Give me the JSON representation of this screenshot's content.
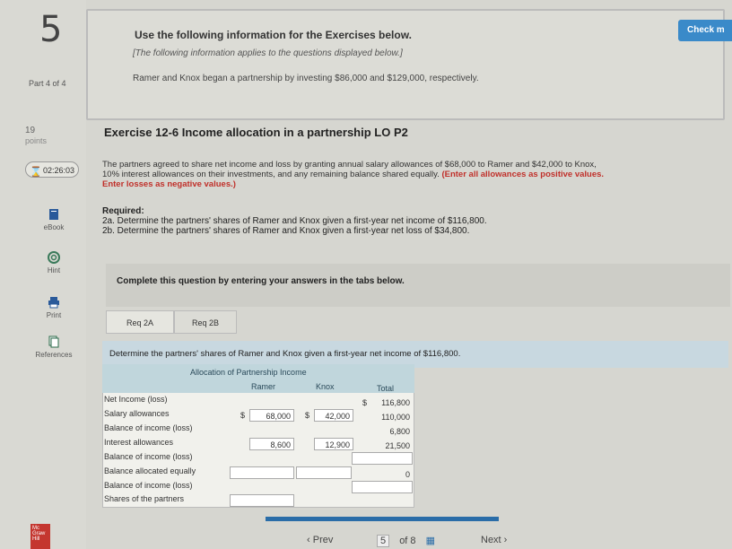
{
  "question_number": "5",
  "part": "Part 4 of 4",
  "points_value": "19",
  "points_label": "points",
  "timer": "02:26:03",
  "tools": [
    "eBook",
    "Hint",
    "Print",
    "References"
  ],
  "check_label": "Check m",
  "info": {
    "use": "Use the following information for the Exercises below.",
    "follow": "[The following information applies to the questions displayed below.]",
    "ramer": "Ramer and Knox began a partnership by investing $86,000 and $129,000, respectively."
  },
  "exercise_title": "Exercise 12-6 Income allocation in a partnership LO P2",
  "description_1": "The partners agreed to share net income and loss by granting annual salary allowances of $68,000 to Ramer and $42,000 to Knox,",
  "description_2": "10% interest allowances on their investments, and any remaining balance shared equally.",
  "description_red_1": "(Enter all allowances as positive values.",
  "description_red_2": "Enter losses as negative values.)",
  "required_label": "Required:",
  "req_2a": "2a. Determine the partners' shares of Ramer and Knox given a first-year net income of $116,800.",
  "req_2b": "2b. Determine the partners' shares of Ramer and Knox given a first-year net loss of $34,800.",
  "complete_text": "Complete this question by entering your answers in the tabs below.",
  "tabs": [
    "Req 2A",
    "Req 2B"
  ],
  "determine_text": "Determine the partners' shares of Ramer and Knox given a first-year net income of $116,800.",
  "table": {
    "title": "Allocation of Partnership Income",
    "col_ramer": "Ramer",
    "col_knox": "Knox",
    "col_total": "Total",
    "rows": [
      {
        "label": "Net Income (loss)",
        "ramer": "",
        "knox": "",
        "total": "116,800"
      },
      {
        "label": "Salary allowances",
        "ramer": "68,000",
        "knox": "42,000",
        "total": "110,000"
      },
      {
        "label": "Balance of income (loss)",
        "ramer": "",
        "knox": "",
        "total": "6,800"
      },
      {
        "label": "Interest allowances",
        "ramer": "8,600",
        "knox": "12,900",
        "total": "21,500"
      },
      {
        "label": "Balance of income (loss)",
        "ramer": "",
        "knox": "",
        "total": ""
      },
      {
        "label": "Balance allocated equally",
        "ramer": "",
        "knox": "",
        "total": "0"
      },
      {
        "label": "Balance of income (loss)",
        "ramer": "",
        "knox": "",
        "total": ""
      },
      {
        "label": "Shares of the partners",
        "ramer": "",
        "knox": "",
        "total": ""
      }
    ],
    "dollar": "$"
  },
  "footer": {
    "prev": "Prev",
    "page_current": "5",
    "page_of": "of 8",
    "next": "Next"
  },
  "logo": "Mc Graw Hill",
  "colors": {
    "accent": "#3a8ac9",
    "red": "#c0302a",
    "progress": "#2a6da8"
  }
}
